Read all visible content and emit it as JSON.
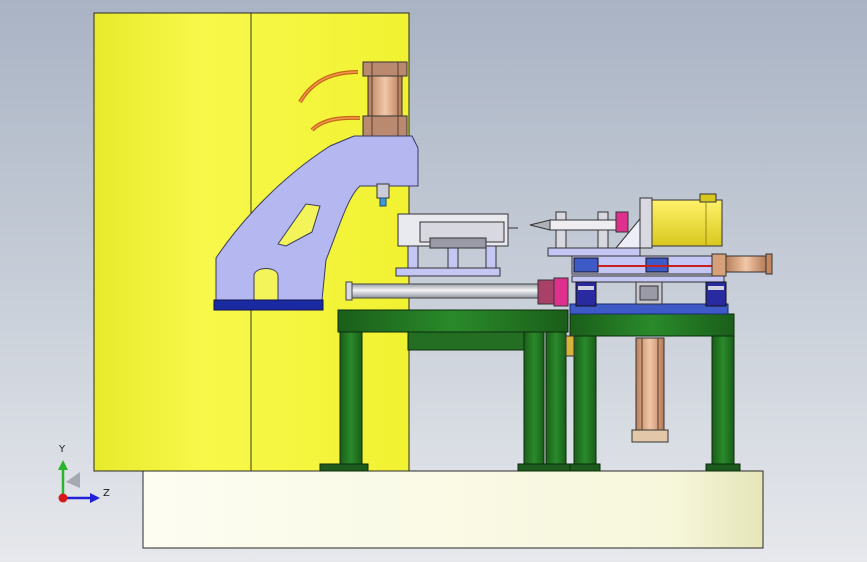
{
  "viewport": {
    "background_top": "#a9b3c4",
    "background_bottom": "#e6e8ec"
  },
  "triad": {
    "y_label": "Y",
    "z_label": "Z",
    "x_label": "",
    "y_color": "#2bb32b",
    "z_color": "#2020d8",
    "x_color": "#d81818"
  },
  "colors": {
    "yellow_column": "#f4f53a",
    "frame_green": "#1f6f1f",
    "arm_lavender": "#b4b6f0",
    "cylinder_copper": "#d6a07a",
    "motor_yellow": "#f2e63a",
    "base_cream": "#fbfbe6",
    "blue_plate": "#1a2aa0",
    "magenta": "#e0308e"
  }
}
